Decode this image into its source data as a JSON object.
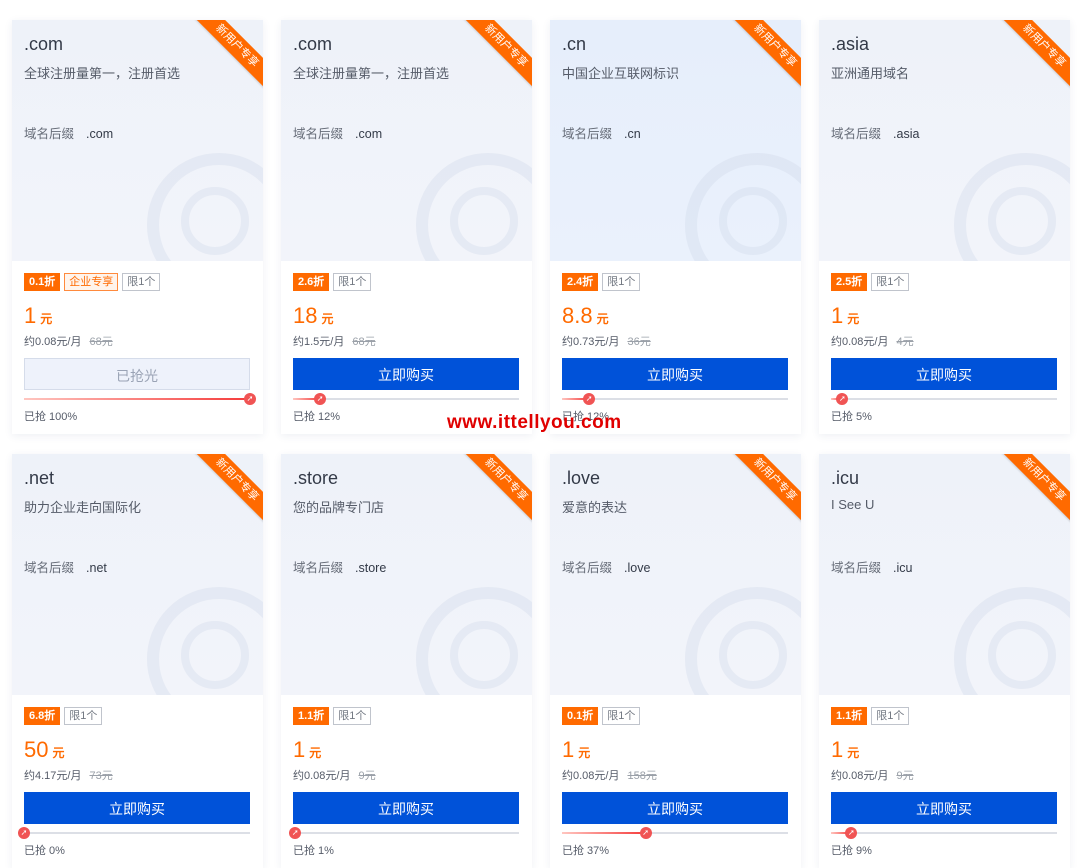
{
  "ribbon_label": "新用户专享",
  "suffix_label": "域名后缀",
  "price_unit": "元",
  "sold_prefix": "已抢",
  "overlay_text": "www.ittellyou.com",
  "colors": {
    "accent": "#ff6a00",
    "button": "#0052d9",
    "progress": "#f05454"
  },
  "cards": [
    {
      "name": ".com",
      "desc": "全球注册量第一，注册首选",
      "suffix": ".com",
      "tags": [
        "0.1折",
        "企业专享",
        "限1个"
      ],
      "price": "1",
      "monthly": "约0.08元/月",
      "original": "68元",
      "button": "已抢光",
      "button_disabled": true,
      "sold_pct": 100,
      "sold_text": "已抢 100%"
    },
    {
      "name": ".com",
      "desc": "全球注册量第一，注册首选",
      "suffix": ".com",
      "tags": [
        "2.6折",
        "限1个"
      ],
      "price": "18",
      "monthly": "约1.5元/月",
      "original": "68元",
      "button": "立即购买",
      "button_disabled": false,
      "sold_pct": 12,
      "sold_text": "已抢 12%"
    },
    {
      "name": ".cn",
      "desc": "中国企业互联网标识",
      "suffix": ".cn",
      "tags": [
        "2.4折",
        "限1个"
      ],
      "price": "8.8",
      "monthly": "约0.73元/月",
      "original": "36元",
      "button": "立即购买",
      "button_disabled": false,
      "sold_pct": 12,
      "sold_text": "已抢 12%"
    },
    {
      "name": ".asia",
      "desc": "亚洲通用域名",
      "suffix": ".asia",
      "tags": [
        "2.5折",
        "限1个"
      ],
      "price": "1",
      "monthly": "约0.08元/月",
      "original": "4元",
      "button": "立即购买",
      "button_disabled": false,
      "sold_pct": 5,
      "sold_text": "已抢 5%"
    },
    {
      "name": ".net",
      "desc": "助力企业走向国际化",
      "suffix": ".net",
      "tags": [
        "6.8折",
        "限1个"
      ],
      "price": "50",
      "monthly": "约4.17元/月",
      "original": "73元",
      "button": "立即购买",
      "button_disabled": false,
      "sold_pct": 0,
      "sold_text": "已抢 0%"
    },
    {
      "name": ".store",
      "desc": "您的品牌专门店",
      "suffix": ".store",
      "tags": [
        "1.1折",
        "限1个"
      ],
      "price": "1",
      "monthly": "约0.08元/月",
      "original": "9元",
      "button": "立即购买",
      "button_disabled": false,
      "sold_pct": 1,
      "sold_text": "已抢 1%"
    },
    {
      "name": ".love",
      "desc": "爱意的表达",
      "suffix": ".love",
      "tags": [
        "0.1折",
        "限1个"
      ],
      "price": "1",
      "monthly": "约0.08元/月",
      "original": "158元",
      "button": "立即购买",
      "button_disabled": false,
      "sold_pct": 37,
      "sold_text": "已抢 37%"
    },
    {
      "name": ".icu",
      "desc": "I See U",
      "suffix": ".icu",
      "tags": [
        "1.1折",
        "限1个"
      ],
      "price": "1",
      "monthly": "约0.08元/月",
      "original": "9元",
      "button": "立即购买",
      "button_disabled": false,
      "sold_pct": 9,
      "sold_text": "已抢 9%"
    }
  ]
}
